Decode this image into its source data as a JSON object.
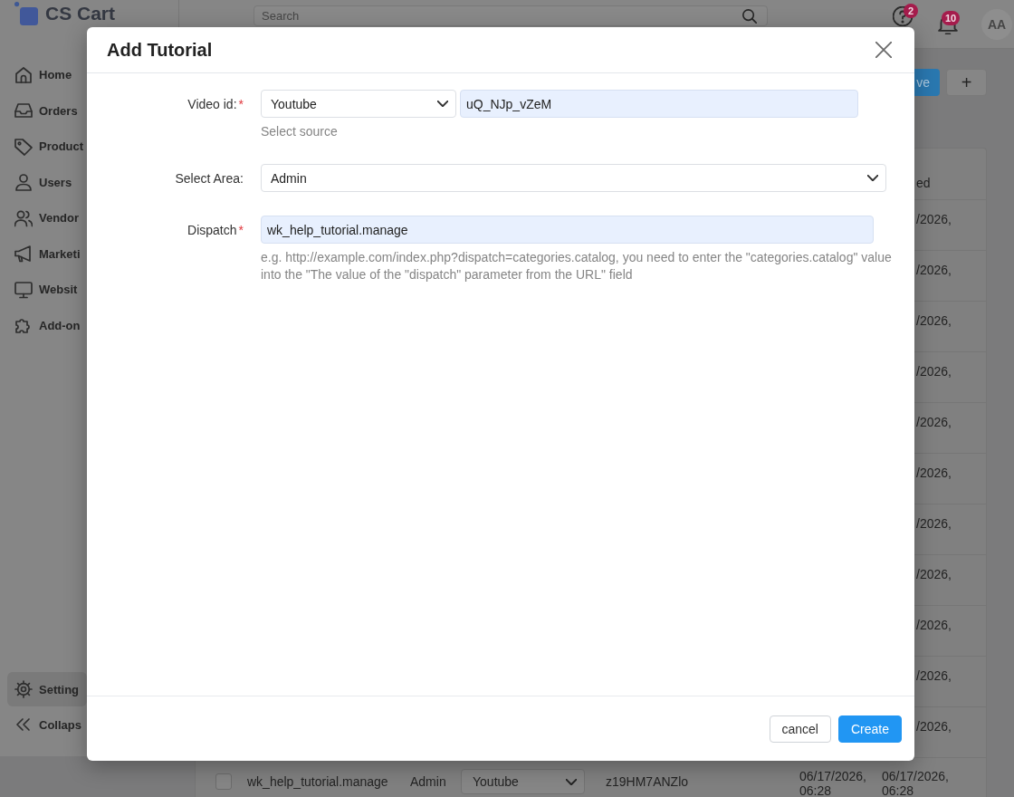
{
  "sidebar": {
    "logo": "CS Cart",
    "items": [
      {
        "label": "Home",
        "selected": false
      },
      {
        "label": "Orders",
        "selected": false
      },
      {
        "label": "Product",
        "selected": false
      },
      {
        "label": "Users",
        "selected": false
      },
      {
        "label": "Vendor",
        "selected": false
      },
      {
        "label": "Marketi",
        "selected": false
      },
      {
        "label": "Websit",
        "selected": false
      },
      {
        "label": "Add-on",
        "selected": false
      }
    ],
    "footer_items": [
      {
        "label": "Setting",
        "selected": true
      }
    ],
    "collapse": "Collaps"
  },
  "header": {
    "search": {
      "placeholder": "Search"
    },
    "help_badge": "2",
    "notification_badge": "10",
    "avatar": "AA"
  },
  "toolbar": {
    "save_button": "ve",
    "add_button": "+"
  },
  "table": {
    "columns": [
      "ed"
    ],
    "rows": [
      {
        "updated": "/2026,"
      },
      {
        "updated": "/2026,"
      },
      {
        "updated": "/2026,"
      },
      {
        "updated": "/2026,"
      },
      {
        "updated": "/2026,"
      },
      {
        "updated": "/2026,"
      },
      {
        "updated": "/2026,"
      },
      {
        "updated": "/2026,"
      },
      {
        "updated": "/2026,"
      },
      {
        "updated": "/2026,"
      },
      {
        "updated": "/2026,"
      },
      {
        "checked": false,
        "dispatch": "wk_help_tutorial.manage",
        "area": "Admin",
        "source": "Youtube",
        "video_id": "z19HM7ANZlo",
        "created": "06/17/2026, 06:28",
        "updated": "06/17/2026, 06:28"
      }
    ]
  },
  "modal": {
    "title": "Add Tutorial",
    "fields": [
      {
        "kind": "source_id",
        "label": "Video id:",
        "required_mark": "*",
        "source": "Youtube",
        "value": "uQ_NJp_vZeM",
        "help": "Select source"
      },
      {
        "kind": "select",
        "label": "Select Area:",
        "value": "Admin"
      },
      {
        "kind": "text",
        "label": "Dispatch",
        "required_mark": "*",
        "value": "wk_help_tutorial.manage",
        "help": "e.g. http://example.com/index.php?dispatch=categories.catalog, you need to enter the \"categories.catalog\" value into the \"The value of the \"dispatch\" parameter from the URL\" field"
      }
    ],
    "buttons": [
      {
        "label": "cancel",
        "kind": "secondary"
      },
      {
        "label": "Create",
        "kind": "primary"
      }
    ]
  }
}
